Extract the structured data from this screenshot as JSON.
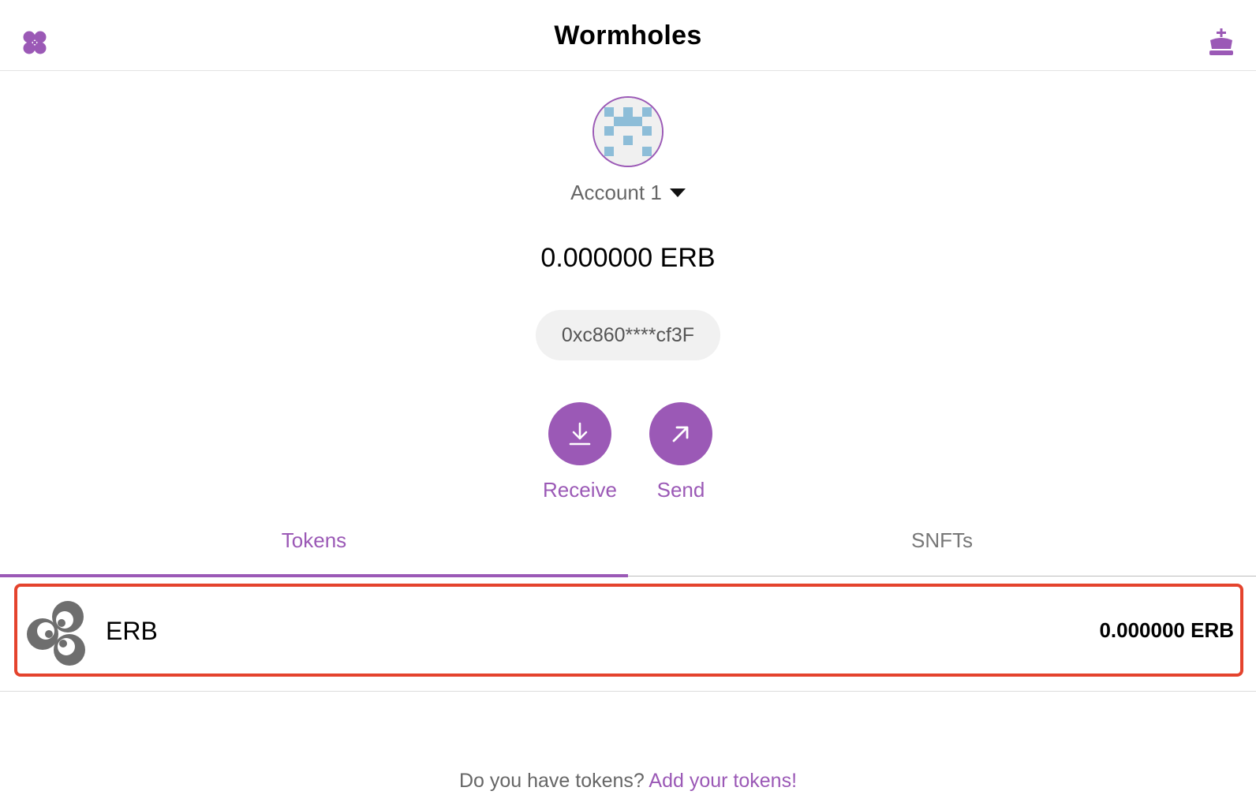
{
  "app": {
    "title": "Wormholes"
  },
  "header": {
    "menu_icon": "clover-menu-icon",
    "crown_icon": "crown-icon"
  },
  "account": {
    "name": "Account 1",
    "balance": "0.000000 ERB",
    "address": "0xc860****cf3F"
  },
  "actions": [
    {
      "label": "Receive",
      "icon": "download-icon"
    },
    {
      "label": "Send",
      "icon": "arrow-up-right-icon"
    }
  ],
  "tabs": [
    {
      "label": "Tokens",
      "active": true
    },
    {
      "label": "SNFTs",
      "active": false
    }
  ],
  "tokens": [
    {
      "symbol": "ERB",
      "balance": "0.000000 ERB",
      "icon": "erb-logo"
    }
  ],
  "footer": {
    "prompt": "Do you have tokens? ",
    "link": "Add your tokens!"
  },
  "colors": {
    "accent": "#9b59b6",
    "highlight": "#e4432d",
    "avatar_pixel": "#8dbdd8"
  }
}
